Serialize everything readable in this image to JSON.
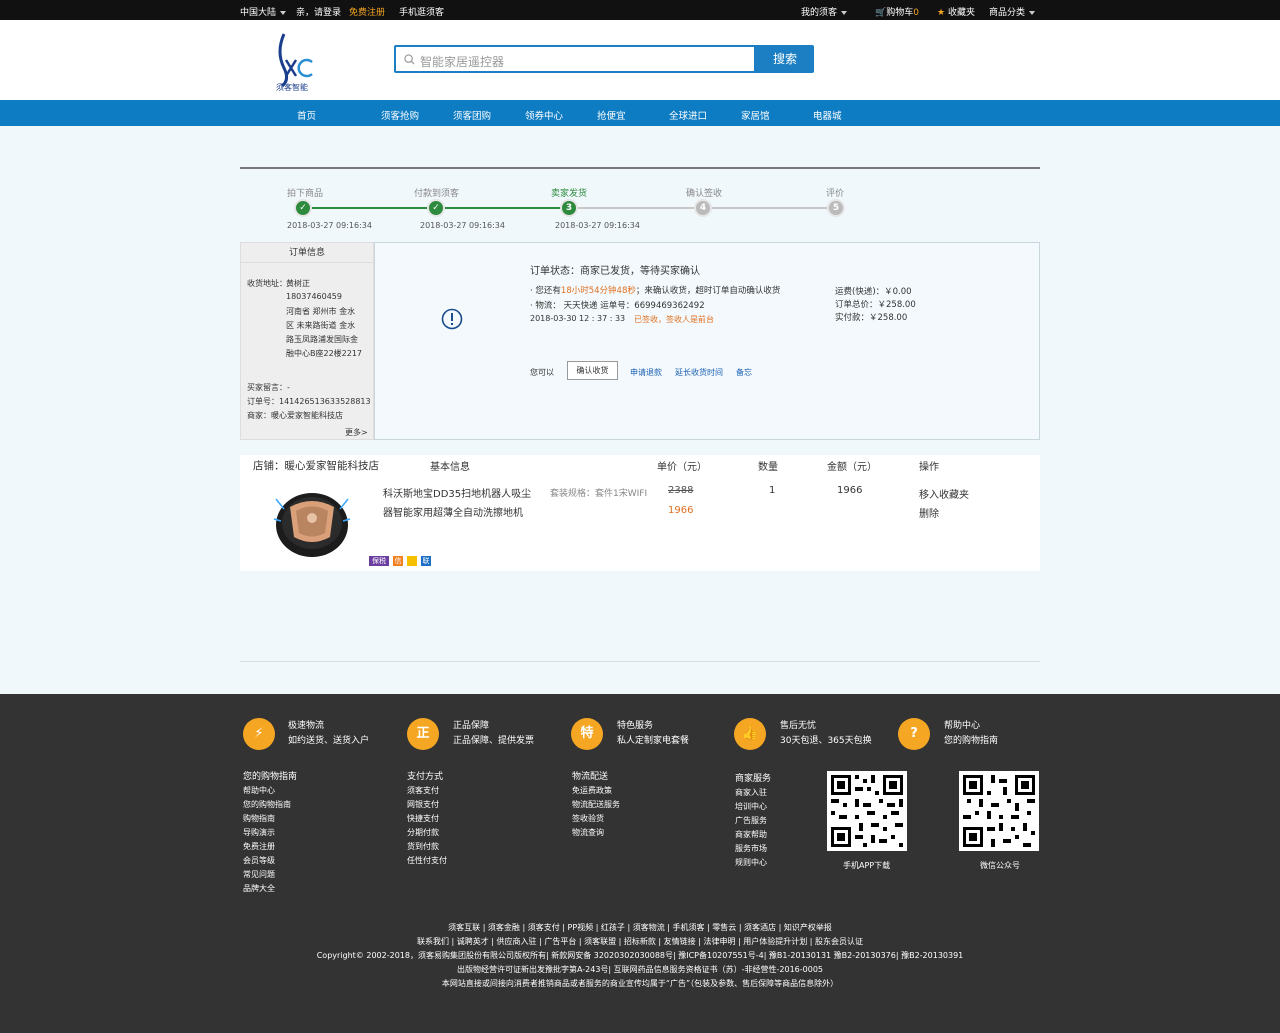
{
  "topbar": {
    "region": "中国大陆",
    "greeting": "亲，请登录",
    "register": "免费注册",
    "mobile": "手机逛须客",
    "my_account": "我的须客",
    "cart": "购物车",
    "cart_count": "0",
    "favorites": "收藏夹",
    "categories": "商品分类"
  },
  "header": {
    "logo_text": "须客智能",
    "search_placeholder": "智能家居遥控器",
    "search_button": "搜索"
  },
  "nav": [
    "首页",
    "须客抢购",
    "须客团购",
    "领券中心",
    "抢便宜",
    "全球进口",
    "家居馆",
    "电器城"
  ],
  "progress": {
    "steps": [
      {
        "label": "拍下商品",
        "date": "2018-03-27 09:16:34",
        "state": "done"
      },
      {
        "label": "付款到须客",
        "date": "2018-03-27 09:16:34",
        "state": "done"
      },
      {
        "label": "卖家发货",
        "date": "2018-03-27 09:16:34",
        "state": "current",
        "num": "3"
      },
      {
        "label": "确认签收",
        "date": "",
        "state": "todo",
        "num": "4"
      },
      {
        "label": "评价",
        "date": "",
        "state": "todo",
        "num": "5"
      }
    ]
  },
  "order_info": {
    "title": "订单信息",
    "addr_label": "收货地址：",
    "name": "黄树正",
    "phone": "18037460459",
    "address_lines": [
      "河南省 郑州市 金水",
      "区 未来路街道 金水",
      "路玉凤路浦发国际金",
      "融中心B座22楼2217"
    ],
    "message": "买家留言：-",
    "order_no": "订单号：141426513633528813",
    "merchant": "商家：暖心爱家智能科技店",
    "more": "更多>"
  },
  "status": {
    "title": "订单状态：商家已发货，等待买家确认",
    "remain_prefix": "· 您还有",
    "remain_time": "18小时54分钟48秒",
    "remain_suffix": "；来确认收货，超时订单自动确认收货",
    "logistics": "· 物流：  天天快递  运单号：6699469362492",
    "log_time": "2018-03-30  12 : 37 : 33",
    "log_status": "已签收，签收人是前台",
    "shipping": "运费(快递)：￥0.00",
    "total": "订单总价：￥258.00",
    "paid": "实付款：￥258.00",
    "you_can": "您可以",
    "confirm_btn": "确认收货",
    "refund": "申请退款",
    "extend": "延长收货时间",
    "note": "备忘"
  },
  "product": {
    "store": "店铺：暖心爱家智能科技店",
    "headers": {
      "basic": "基本信息",
      "price": "单价（元）",
      "qty": "数量",
      "amount": "金额（元）",
      "ops": "操作"
    },
    "name_line1": "科沃斯地宝DD35扫地机器人吸尘",
    "name_line2": "器智能家用超薄全自动洗擦地机",
    "spec": "套装规格：套件1宋WIFI",
    "orig_price": "2388",
    "price": "1966",
    "qty": "1",
    "amount": "1966",
    "op_fav": "移入收藏夹",
    "op_del": "删除",
    "badges": [
      "保税",
      "信",
      "",
      "联"
    ]
  },
  "footer": {
    "features": [
      {
        "icon": "lightning-icon",
        "title": "极速物流",
        "sub": "如约送货、送货入户"
      },
      {
        "icon": "genuine-icon",
        "title": "正品保障",
        "sub": "正品保障、提供发票"
      },
      {
        "icon": "special-icon",
        "title": "特色服务",
        "sub": "私人定制家电套餐"
      },
      {
        "icon": "thumbs-up-icon",
        "title": "售后无忧",
        "sub": "30天包退、365天包换"
      },
      {
        "icon": "help-icon",
        "title": "帮助中心",
        "sub": "您的购物指南"
      }
    ],
    "columns": [
      {
        "title": "您的购物指南",
        "items": [
          "帮助中心",
          "您的购物指南",
          "购物指南",
          "导购演示",
          "免费注册",
          "会员等级",
          "常见问题",
          "品牌大全"
        ]
      },
      {
        "title": "支付方式",
        "items": [
          "须客支付",
          "网银支付",
          "快捷支付",
          "分期付款",
          "货到付款",
          "任性付支付"
        ]
      },
      {
        "title": "物流配送",
        "items": [
          "免运费政策",
          "物流配送服务",
          "签收验货",
          "物流查询"
        ]
      },
      {
        "title": "商家服务",
        "items": [
          "商家入驻",
          "培训中心",
          "广告服务",
          "商家帮助",
          "服务市场",
          "规则中心"
        ]
      }
    ],
    "qr_app": "手机APP下载",
    "qr_wechat": "微信公众号",
    "links1": "须客互联 | 须客金融 | 须客支付 | PP视频 | 红孩子 | 须客物流 | 手机须客 | 零售云 | 须客酒店 | 知识产权举报",
    "links2": "联系我们 | 诚聘英才 | 供应商入驻 | 广告平台 | 须客联盟 | 招标新款 | 友情链接 | 法律申明 | 用户体验提升计划 | 股东会员认证",
    "copyright": "Copyright© 2002-2018，须客易购集团股份有限公司版权所有| 新款网安备 32020302030088号| 豫ICP备10207551号-4| 豫B1-20130131 豫B2-20130376| 豫B2-20130391",
    "license": "出版物经营许可证新出发豫批字第A-243号| 互联网药品信息服务资格证书（苏）-非经营性-2016-0005",
    "disclaimer": "本网站直接或间接向消费者推销商品或者服务的商业宣传均属于“广告”（包装及参数、售后保障等商品信息除外）"
  }
}
